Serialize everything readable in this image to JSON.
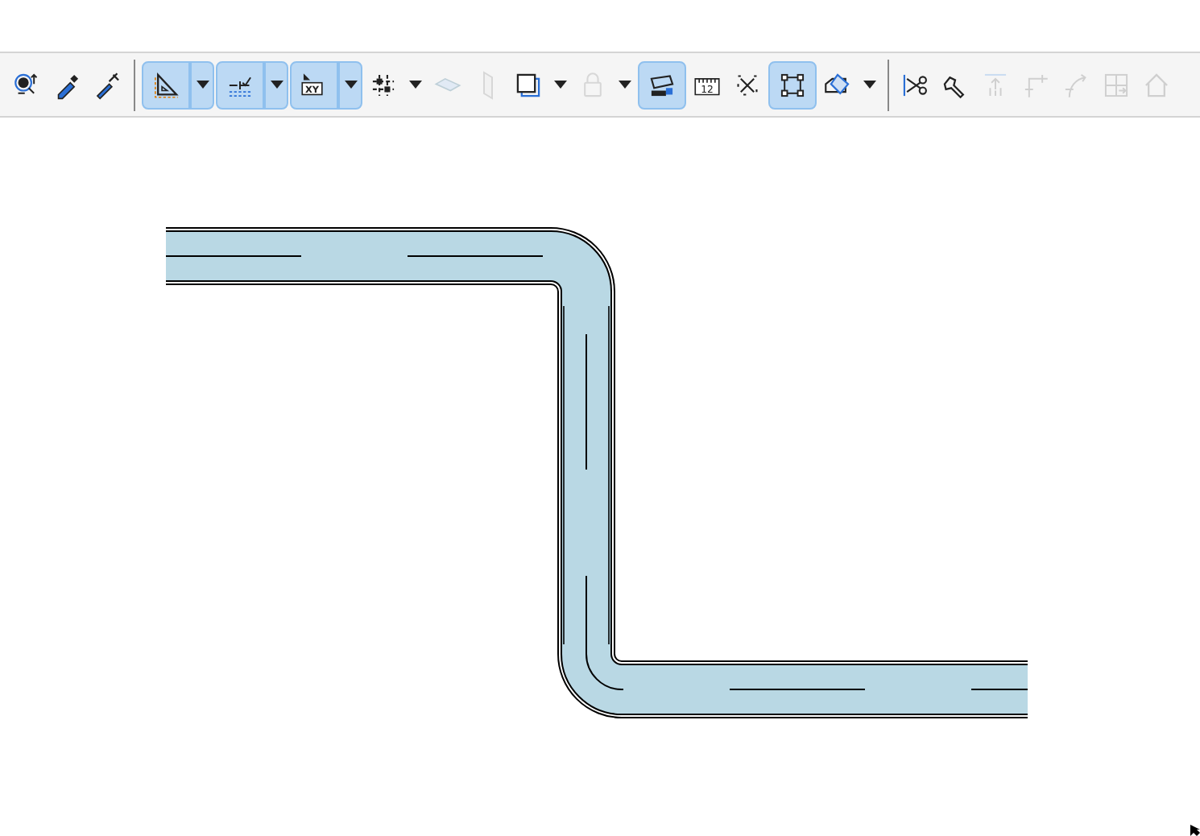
{
  "toolbar": {
    "groups": [
      {
        "items": [
          {
            "selected": false,
            "disabled": false,
            "dropdown": false
          },
          {
            "selected": false,
            "disabled": false,
            "dropdown": false
          },
          {
            "selected": false,
            "disabled": false,
            "dropdown": false
          }
        ]
      },
      {
        "items": [
          {
            "selected": true,
            "disabled": false,
            "dropdown": true
          },
          {
            "selected": true,
            "disabled": false,
            "dropdown": true
          },
          {
            "selected": true,
            "disabled": false,
            "dropdown": true,
            "glyph": "XY"
          },
          {
            "selected": false,
            "disabled": false,
            "dropdown": true
          },
          {
            "selected": false,
            "disabled": true,
            "dropdown": false
          },
          {
            "selected": false,
            "disabled": true,
            "dropdown": false
          },
          {
            "selected": false,
            "disabled": false,
            "dropdown": true
          },
          {
            "selected": false,
            "disabled": true,
            "dropdown": true
          },
          {
            "selected": true,
            "disabled": false,
            "dropdown": false
          },
          {
            "selected": false,
            "disabled": false,
            "dropdown": false,
            "glyph": "12"
          },
          {
            "selected": false,
            "disabled": false,
            "dropdown": false
          },
          {
            "selected": true,
            "disabled": false,
            "dropdown": false
          },
          {
            "selected": false,
            "disabled": false,
            "dropdown": true
          }
        ]
      },
      {
        "items": [
          {
            "selected": false,
            "disabled": false,
            "dropdown": false
          },
          {
            "selected": false,
            "disabled": false,
            "dropdown": false
          },
          {
            "selected": false,
            "disabled": true,
            "dropdown": false
          },
          {
            "selected": false,
            "disabled": true,
            "dropdown": false
          },
          {
            "selected": false,
            "disabled": true,
            "dropdown": false
          },
          {
            "selected": false,
            "disabled": true,
            "dropdown": false
          },
          {
            "selected": false,
            "disabled": true,
            "dropdown": false
          }
        ]
      }
    ]
  }
}
